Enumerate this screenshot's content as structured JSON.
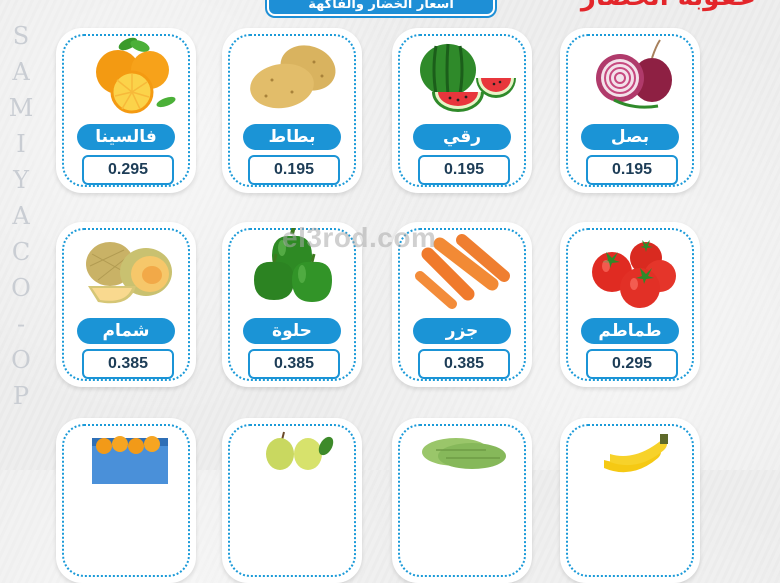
{
  "header": {
    "title": "عقوبة الخضار",
    "banner": "أسعار الخضار والفاكهة"
  },
  "sidebar_brand": [
    "S",
    "A",
    "M",
    "I",
    "Y",
    "A",
    "C",
    "O",
    "-",
    "O",
    "P"
  ],
  "watermark": "el3rod.com",
  "items": [
    {
      "name": "فالسينا",
      "price": "0.295",
      "icon": "orange-icon"
    },
    {
      "name": "بطاط",
      "price": "0.195",
      "icon": "potato-icon"
    },
    {
      "name": "رقي",
      "price": "0.195",
      "icon": "watermelon-icon"
    },
    {
      "name": "بصل",
      "price": "0.195",
      "icon": "onion-icon"
    },
    {
      "name": "شمام",
      "price": "0.385",
      "icon": "melon-icon"
    },
    {
      "name": "حلوة",
      "price": "0.385",
      "icon": "bell-pepper-icon"
    },
    {
      "name": "جزر",
      "price": "0.385",
      "icon": "carrot-icon"
    },
    {
      "name": "طماطم",
      "price": "0.295",
      "icon": "tomato-icon"
    },
    {
      "name": "",
      "price": "",
      "icon": "fruit-box-icon"
    },
    {
      "name": "",
      "price": "",
      "icon": "pear-icon"
    },
    {
      "name": "",
      "price": "",
      "icon": "zucchini-icon"
    },
    {
      "name": "",
      "price": "",
      "icon": "banana-icon"
    }
  ],
  "colors": {
    "accent_blue": "#1b94d6",
    "title_red": "#e3262b",
    "price_text": "#1d3d57"
  }
}
